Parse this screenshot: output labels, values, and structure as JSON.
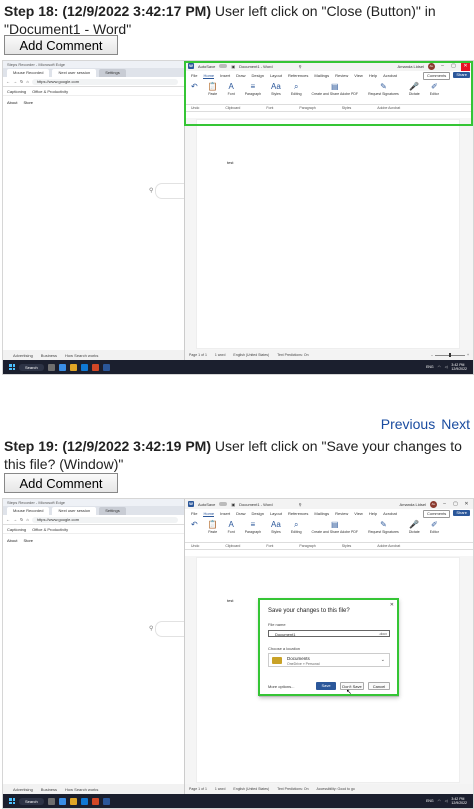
{
  "step18": {
    "prefix": "Step 18: (12/9/2022 3:42:17 PM)",
    "description": "User left click on \"Close (Button)\" in \"Document1 - Word\""
  },
  "step19": {
    "prefix": "Step 19: (12/9/2022 3:42:19 PM)",
    "description": "User left click on \"Save your changes to this file? (Window)\""
  },
  "add_comment_label": "Add Comment",
  "nav": {
    "previous": "Previous",
    "next": "Next"
  },
  "browser": {
    "titlebar": "Steps Recorder - Microsoft Edge",
    "tab1": "Mouse Recorded",
    "tab2": "Next user session",
    "tab3": "Settings",
    "url": "https://www.google.com",
    "bookmark1": "Captioning",
    "bookmark2": "Office & Productivity",
    "link_about": "About",
    "link_store": "Store",
    "footer": [
      "Advertising",
      "Business",
      "How Search works"
    ]
  },
  "word": {
    "autosave": "AutoSave",
    "title": "Document1 - Word",
    "user": "Amanda Lidsel",
    "avatar_initials": "AL",
    "menu": [
      "File",
      "Home",
      "Insert",
      "Draw",
      "Design",
      "Layout",
      "References",
      "Mailings",
      "Review",
      "View",
      "Help",
      "Acrobat"
    ],
    "comments": "Comments",
    "share": "Share",
    "ribbon": [
      {
        "icon": "↶",
        "label": "Undo"
      },
      {
        "icon": "📋",
        "label": "Paste"
      },
      {
        "icon": "A",
        "label": "Font"
      },
      {
        "icon": "≡",
        "label": "Paragraph"
      },
      {
        "icon": "Aa",
        "label": "Styles"
      },
      {
        "icon": "⌕",
        "label": "Editing"
      },
      {
        "icon": "▤",
        "label": "Create and Share Adobe PDF"
      },
      {
        "icon": "✎",
        "label": "Request Signatures"
      },
      {
        "icon": "🎤",
        "label": "Dictate"
      },
      {
        "icon": "✐",
        "label": "Editor"
      }
    ],
    "group_labels": [
      "Undo",
      "Clipboard",
      "Font",
      "Paragraph",
      "Styles",
      "Adobe Acrobat",
      "Voice",
      "Editor"
    ],
    "doc_text": "test",
    "status": [
      "Page 1 of 1",
      "1 word",
      "English (United States)",
      "Text Predictions: On",
      "Accessibility: Good to go"
    ]
  },
  "dialog": {
    "title": "Save your changes to this file?",
    "filename_label": "File name",
    "filename": "Document1",
    "ext": ".docx",
    "location_label": "Choose a location",
    "location_name": "Documents",
    "location_sub": "OneDrive » Personal",
    "more_options": "More options...",
    "save": "Save",
    "dont_save": "Don't Save",
    "cancel": "Cancel"
  },
  "taskbar": {
    "search": "Search",
    "tray_lang": "ENG",
    "time": "3:42 PM",
    "date": "12/9/2022"
  },
  "colors": {
    "highlight": "#35c535",
    "word_blue": "#2b579a",
    "link": "#1a4ca0",
    "close_red": "#e81123"
  }
}
